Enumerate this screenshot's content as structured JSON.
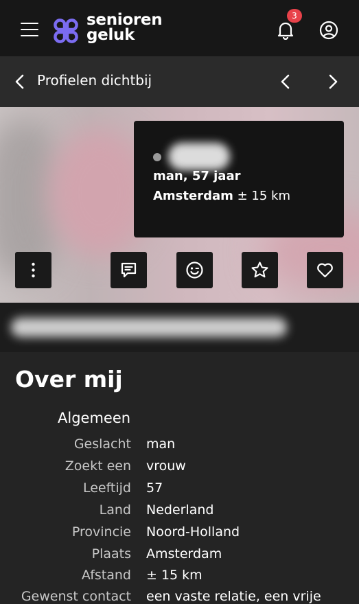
{
  "header": {
    "logo_line1": "senioren",
    "logo_line2": "geluk",
    "notification_count": "3"
  },
  "nav": {
    "title": "Profielen dichtbij"
  },
  "profile": {
    "age_line": "man, 57 jaar",
    "city": "Amsterdam",
    "distance": " ± 15 km"
  },
  "about": {
    "title": "Over mij",
    "section": "Algemeen",
    "rows": [
      {
        "label": "Geslacht",
        "value": "man"
      },
      {
        "label": "Zoekt een",
        "value": "vrouw"
      },
      {
        "label": "Leeftijd",
        "value": "57"
      },
      {
        "label": "Land",
        "value": "Nederland"
      },
      {
        "label": "Provincie",
        "value": "Noord-Holland"
      },
      {
        "label": "Plaats",
        "value": "Amsterdam"
      },
      {
        "label": "Afstand",
        "value": "± 15 km"
      },
      {
        "label": "Gewenst contact",
        "value": "een vaste relatie, een vrije"
      }
    ]
  },
  "colors": {
    "brand": "#7b6cf0",
    "badge": "#e8424a"
  },
  "icons": [
    "menu-icon",
    "logo-icon",
    "bell-icon",
    "user-circle-icon",
    "chevron-left-icon",
    "chevron-right-icon",
    "more-vertical-icon",
    "message-icon",
    "smile-icon",
    "star-icon",
    "heart-icon"
  ]
}
